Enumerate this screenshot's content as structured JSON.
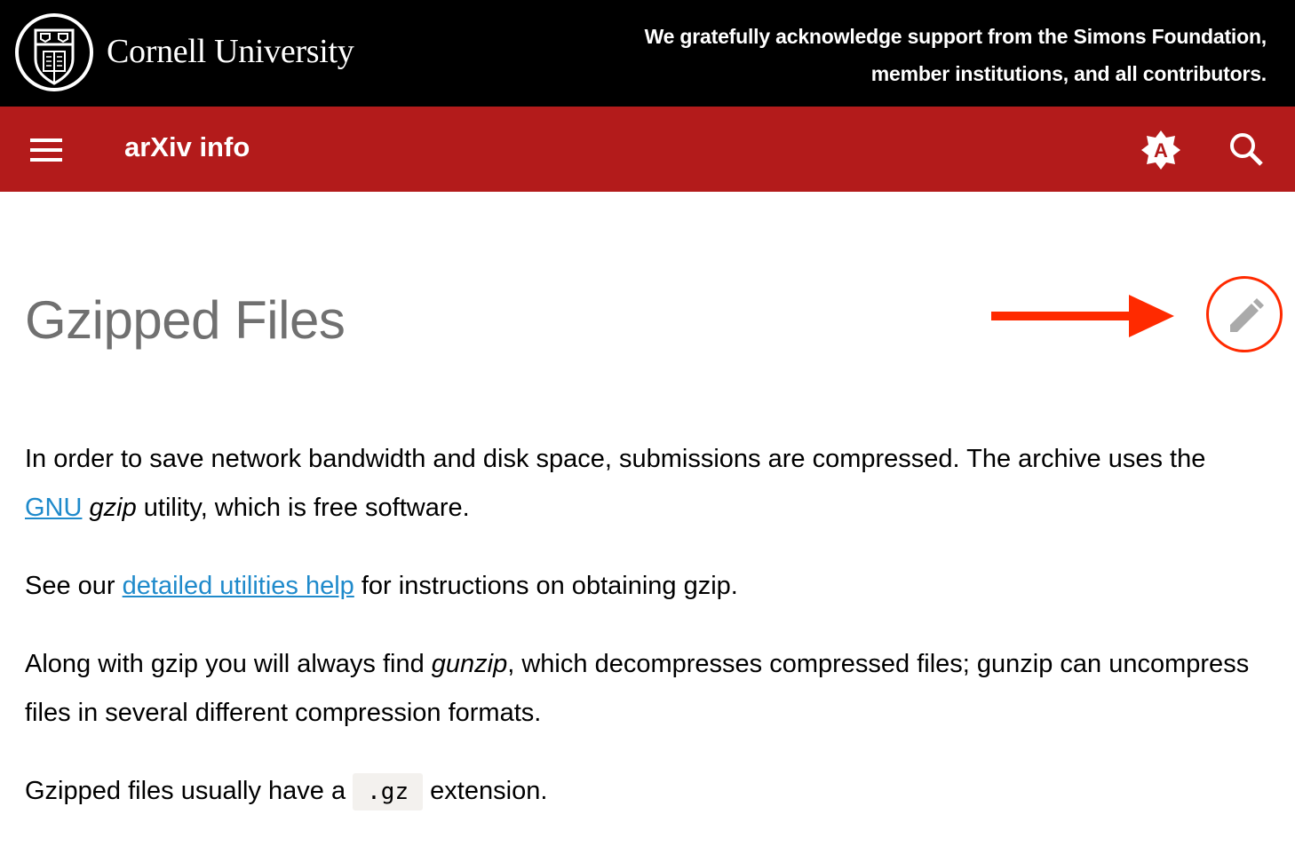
{
  "header": {
    "institution_name": "Cornell University",
    "support_line1": "We gratefully acknowledge support from the Simons Foundation,",
    "support_line2": "member institutions, and all contributors."
  },
  "navbar": {
    "title": "arXiv info",
    "menu_icon": "hamburger-menu-icon",
    "accessibility_icon": "auto-brightness-a-icon",
    "accessibility_letter": "A",
    "search_icon": "search-icon",
    "background_color": "#b31b1b"
  },
  "page": {
    "title": "Gzipped Files",
    "edit_icon": "pencil-icon",
    "annotation_color": "#ff2a00"
  },
  "content": {
    "p1": {
      "text_before": "In order to save network bandwidth and disk space, submissions are compressed. The archive uses the ",
      "link": "GNU",
      "space": " ",
      "emph": "gzip",
      "text_after": " utility, which is free software."
    },
    "p2": {
      "text_before": "See our ",
      "link": "detailed utilities help",
      "text_after": " for instructions on obtaining gzip."
    },
    "p3": {
      "text_before": "Along with gzip you will always find ",
      "emph": "gunzip",
      "text_after": ", which decompresses compressed files; gunzip can uncompress files in several different compression formats."
    },
    "p4": {
      "text_before": "Gzipped files usually have a ",
      "code": ".gz",
      "text_after": " extension."
    },
    "link_color": "#1f8acb"
  }
}
